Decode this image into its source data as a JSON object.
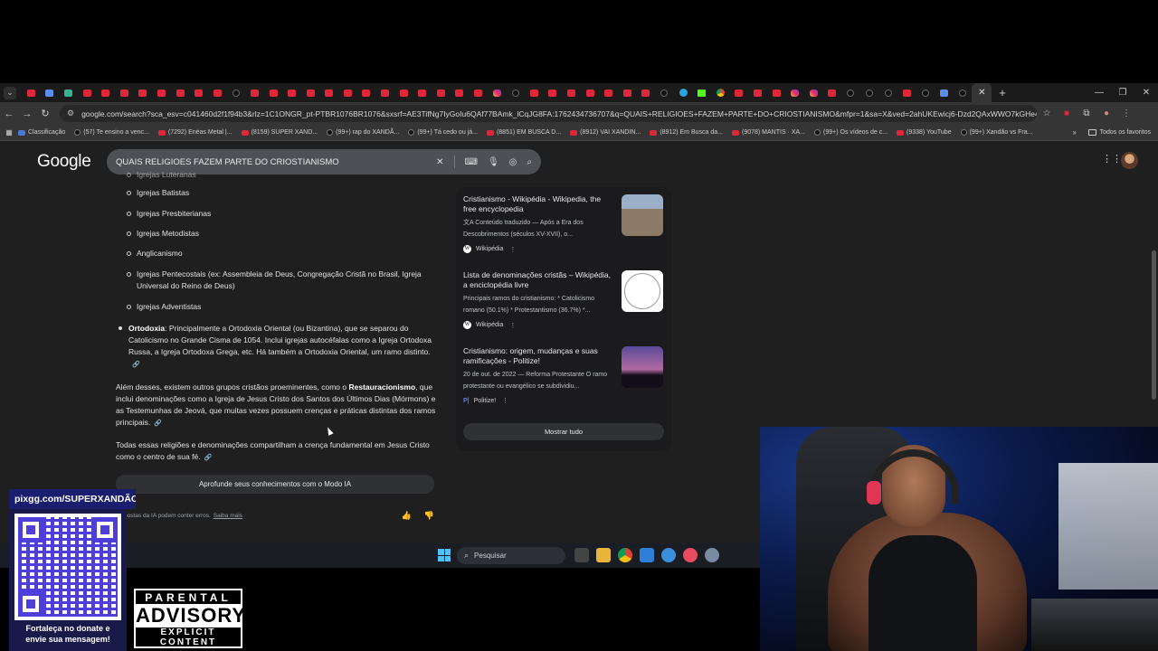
{
  "browser": {
    "tabs": [
      "yt",
      "gm",
      "gn",
      "yt",
      "yt",
      "yt",
      "yt",
      "yt",
      "yt",
      "yt",
      "yt",
      "tt",
      "yt",
      "yt",
      "yt",
      "yt",
      "yt",
      "yt",
      "yt",
      "yt",
      "yt",
      "yt",
      "yt",
      "yt",
      "yt",
      "ig",
      "tt",
      "yt",
      "yt",
      "yt",
      "yt",
      "yt",
      "yt",
      "yt",
      "tt",
      "tg",
      "kk",
      "ch",
      "yt",
      "yt",
      "yt",
      "ig",
      "ig",
      "yt",
      "tt",
      "tt",
      "tt",
      "yt",
      "tt",
      "gm",
      "tt"
    ],
    "url": "google.com/search?sca_esv=c041460d2f1f94b3&rlz=1C1ONGR_pt-PTBR1076BR1076&sxsrf=AE3TifNg7IyGoIu6QAf77BAmk_lCqJG8FA:1762434736707&q=QUAIS+RELIGIOES+FAZEM+PARTE+DO+CRIOSTIANISMO&mfpr=1&sa=X&ved=2ahUKEwicj6-Dzd2QAxWWO7kGHe4OGnoQvgUoAXoECA0QAg&bi...",
    "bookmarks": [
      {
        "label": "Classificação",
        "kind": "cl"
      },
      {
        "label": "(57) Te ensino a venc...",
        "kind": "tt"
      },
      {
        "label": "(7292) Enéas Metal |...",
        "kind": "yt"
      },
      {
        "label": "(8159) SUPER XAND...",
        "kind": "yt"
      },
      {
        "label": "(99+) rap do XANDÃ...",
        "kind": "tt"
      },
      {
        "label": "(99+) Tá cedo ou já...",
        "kind": "tt"
      },
      {
        "label": "(8851) EM BUSCA D...",
        "kind": "yt"
      },
      {
        "label": "(8912) VAI XANDIN...",
        "kind": "yt"
      },
      {
        "label": "(8912) Em Busca da...",
        "kind": "yt"
      },
      {
        "label": "(9078) MANTIS · XA...",
        "kind": "yt"
      },
      {
        "label": "(99+) Os vídeos de c...",
        "kind": "tt"
      },
      {
        "label": "(9338) YouTube",
        "kind": "yt"
      },
      {
        "label": "(99+) Xandão vs Fra...",
        "kind": "tt"
      }
    ],
    "favorites_label": "Todos os favoritos"
  },
  "search": {
    "logo": "Google",
    "query": "QUAIS RELIGIOES FAZEM PARTE DO CRIOSTIANISMO"
  },
  "ai_overview": {
    "partial_item": "Igrejas Luteranas",
    "sub_items": [
      "Igrejas Batistas",
      "Igrejas Presbiterianas",
      "Igrejas Metodistas",
      "Anglicanismo",
      "Igrejas Pentecostais (ex: Assembleia de Deus, Congregação Cristã no Brasil, Igreja Universal do Reino de Deus)",
      "Igrejas Adventistas"
    ],
    "ortodoxia_bold": "Ortodoxia",
    "ortodoxia_text": ": Principalmente a Ortodoxia Oriental (ou Bizantina), que se separou do Catolicismo no Grande Cisma de 1054. Inclui igrejas autocéfalas como a Igreja Ortodoxa Russa, a Igreja Ortodoxa Grega, etc. Há também a Ortodoxia Oriental, um ramo distinto.",
    "para1_a": "Além desses, existem outros grupos cristãos proeminentes, como o ",
    "para1_bold": "Restauracionismo",
    "para1_b": ", que inclui denominações como a Igreja de Jesus Cristo dos Santos dos Últimos Dias (Mórmons) e as Testemunhas de Jeová, que muitas vezes possuem crenças e práticas distintas dos ramos principais.",
    "para2": "Todas essas religiões e denominações compartilham a crença fundamental em Jesus Cristo como o centro de sua fé.",
    "button": "Aprofunde seus conhecimentos com o Modo IA",
    "footer": "respostas da IA podem conter erros.",
    "footer_link": "Saiba mais"
  },
  "sources": [
    {
      "title": "Cristianismo - Wikipédia - Wikipedia, the free encyclopedia",
      "desc": "文A Conteúdo traduzido — Após a Era dos Descobrimentos (séculos XV-XVII), o...",
      "site": "Wikipédia"
    },
    {
      "title": "Lista de denominações cristãs – Wikipédia, a enciclopédia livre",
      "desc": "Principais ramos do cristianismo: * Catolicismo romano (50.1%) * Protestantismo (36.7%) *...",
      "site": "Wikipédia"
    },
    {
      "title": "Cristianismo: origem, mudanças e suas ramificações - Politize!",
      "desc": "20 de out. de 2022 — Reforma Protestante O ramo protestante ou evangélico se subdividiu...",
      "site": "Politize!"
    }
  ],
  "show_all": "Mostrar tudo",
  "taskbar": {
    "search": "Pesquisar"
  },
  "overlay": {
    "donate_url": "pixgg.com/SUPERXANDÃO",
    "donate_msg_1": "Fortaleça no donate e",
    "donate_msg_2": "envie sua mensagem!",
    "advisory_1": "PARENTAL",
    "advisory_2": "ADVISORY",
    "advisory_3": "EXPLICIT CONTENT"
  },
  "colors": {
    "page_bg": "#1f1f1f",
    "chrome_bg": "#353535",
    "youtube_red": "#e0263b",
    "qr_color": "#3b2bd6",
    "donate_bg": "#1b1d6e"
  }
}
